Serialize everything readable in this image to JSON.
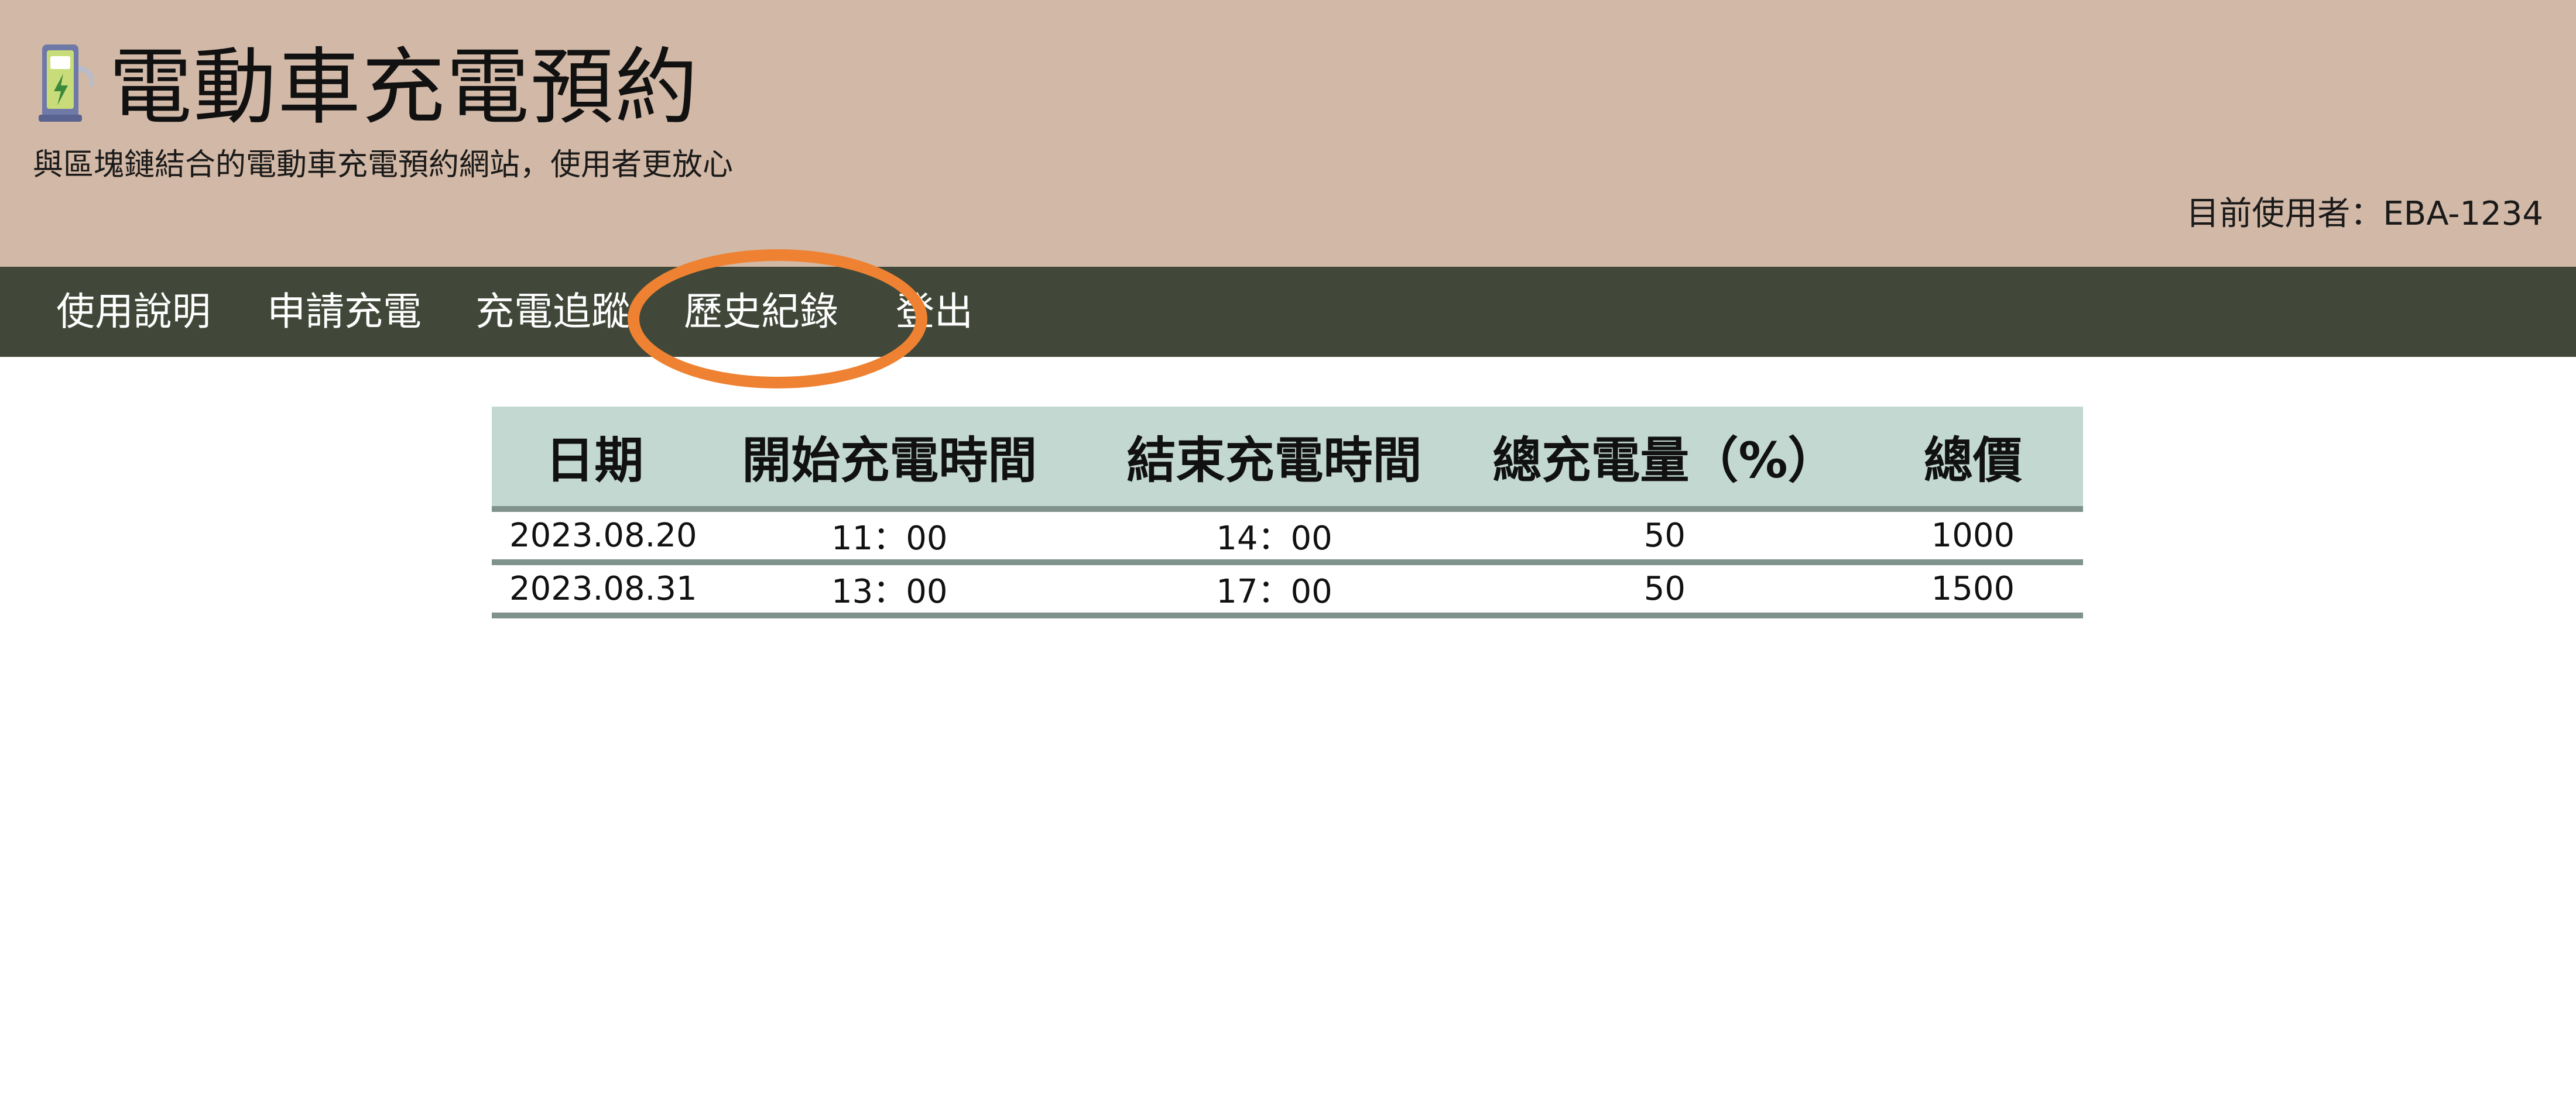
{
  "header": {
    "title": "電動車充電預約",
    "subtitle": "與區塊鏈結合的電動車充電預約網站，使用者更放心",
    "current_user": "目前使用者：EBA-1234",
    "logo_icon": "ev-charger-icon"
  },
  "nav": {
    "items": [
      {
        "label": "使用說明"
      },
      {
        "label": "申請充電"
      },
      {
        "label": "充電追蹤"
      },
      {
        "label": "歷史紀錄",
        "highlighted": true
      },
      {
        "label": "登出"
      }
    ],
    "highlight_color": "#ee8232"
  },
  "table": {
    "headers": [
      "日期",
      "開始充電時間",
      "結束充電時間",
      "總充電量（%）",
      "總價"
    ],
    "rows": [
      [
        "2023.08.20",
        "11：00",
        "14：00",
        "50",
        "1000"
      ],
      [
        "2023.08.31",
        "13：00",
        "17：00",
        "50",
        "1500"
      ]
    ]
  },
  "colors": {
    "header_bg": "#d2b8a6",
    "nav_bg": "#414839",
    "table_header_bg": "#c2d8d0",
    "table_rule": "#7f928c"
  }
}
